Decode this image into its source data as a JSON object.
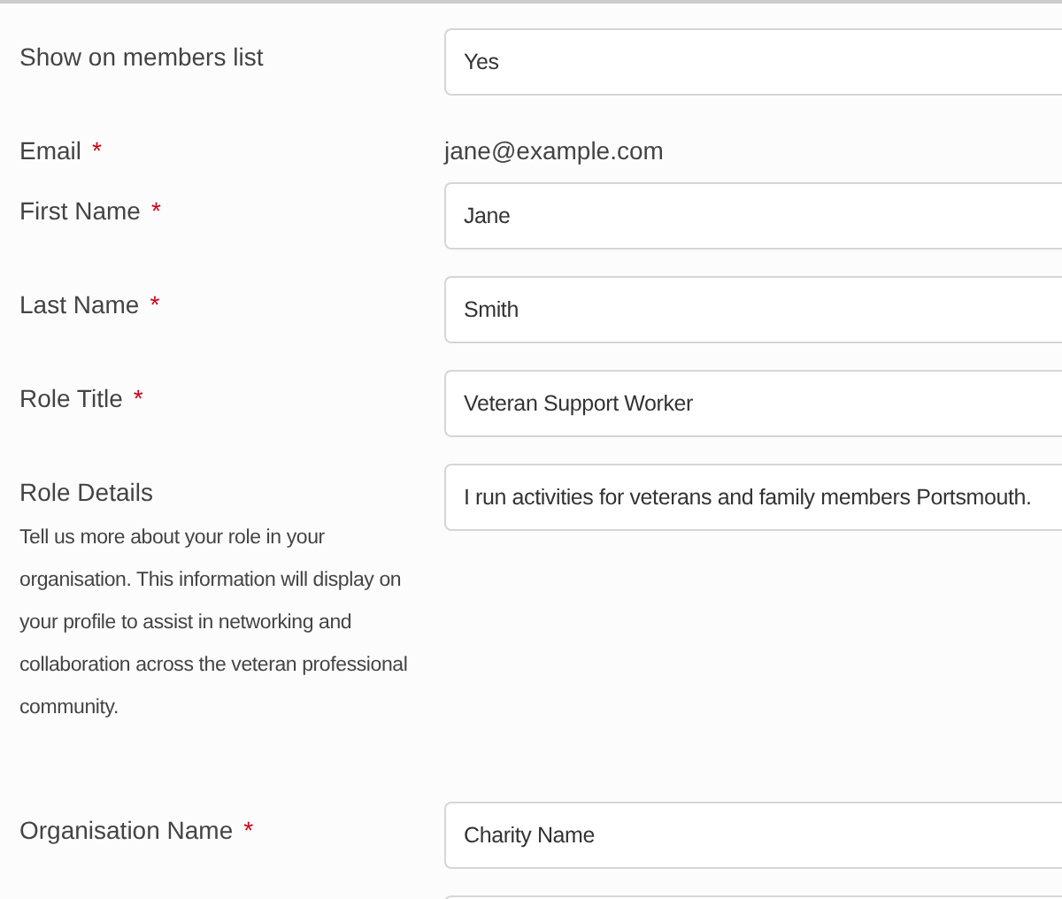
{
  "fields": [
    {
      "kind": "input",
      "label": "Show on members list",
      "value": "Yes"
    },
    {
      "kind": "static",
      "label": "Email",
      "required_mark": "*",
      "value": "jane@example.com"
    },
    {
      "kind": "input",
      "label": "First Name",
      "required_mark": "*",
      "value": "Jane"
    },
    {
      "kind": "input",
      "label": "Last Name",
      "required_mark": "*",
      "value": "Smith"
    },
    {
      "kind": "input",
      "label": "Role Title",
      "required_mark": "*",
      "value": "Veteran Support Worker"
    },
    {
      "kind": "input",
      "label": "Role Details",
      "help": "Tell us more about your role in your organisation. This information will display on your profile to assist in networking and collaboration across the veteran professional community.",
      "value": "I run activities for veterans and family members Portsmouth."
    },
    {
      "kind": "input",
      "label": "Organisation Name",
      "required_mark": "*",
      "value": "Charity Name"
    }
  ]
}
